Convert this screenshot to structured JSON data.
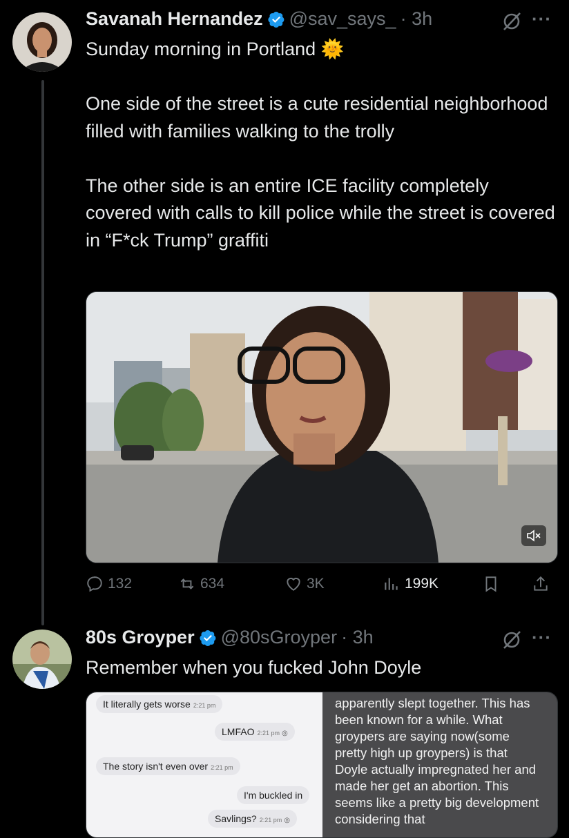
{
  "tweet1": {
    "name": "Savanah Hernandez",
    "handle": "@sav_says_",
    "time": "· 3h",
    "line1": "Sunday morning in Portland",
    "emoji": "🌞",
    "body": "One side of the street is a cute residential neighborhood filled with families walking to the trolly\n\nThe other side is an entire ICE facility completely covered with calls to kill police while the street is covered in “F*ck Trump” graffiti",
    "actions": {
      "replies": "132",
      "reposts": "634",
      "likes": "3K",
      "views": "199K"
    }
  },
  "tweet2": {
    "name": "80s Groyper",
    "handle": "@80sGroyper",
    "time": "· 3h",
    "text": "Remember when you fucked John Doyle",
    "chat": [
      {
        "text": "It literally gets worse",
        "time": "2:21 pm",
        "side": "in"
      },
      {
        "text": "LMFAO",
        "time": "2:21 pm",
        "side": "out"
      },
      {
        "text": "The story isn't even over",
        "time": "2:21 pm",
        "side": "in"
      },
      {
        "text": "I'm buckled in",
        "time": "",
        "side": "out"
      },
      {
        "text": "Savlings?",
        "time": "2:21 pm",
        "side": "out"
      }
    ],
    "note": "apparently slept together. This has been known for a while. What groypers are saying now(some pretty high up groypers) is that Doyle actually impregnated her and made her get an abortion. This seems like a pretty big development considering that"
  },
  "icons": {
    "verified": "verified-badge-icon",
    "grok": "grok-icon",
    "more": "more-icon",
    "reply": "reply-icon",
    "repost": "repost-icon",
    "like": "like-icon",
    "views": "views-icon",
    "bookmark": "bookmark-icon",
    "share": "share-icon",
    "mute": "mute-icon"
  },
  "colors": {
    "background": "#000000",
    "text": "#e7e9ea",
    "muted": "#71767b",
    "verified": "#1d9bf0"
  }
}
